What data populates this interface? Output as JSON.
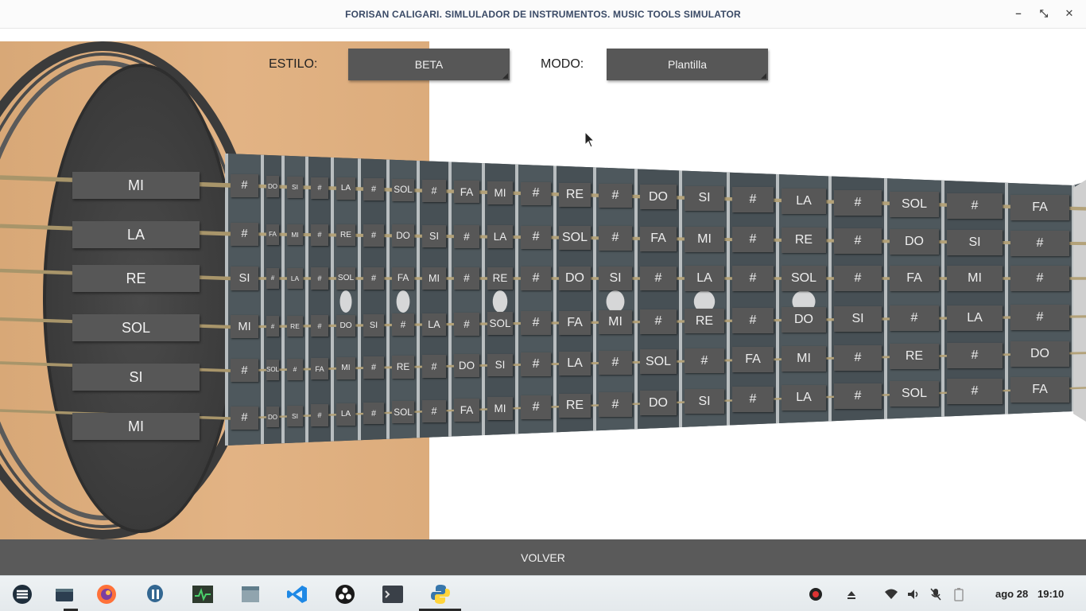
{
  "window": {
    "title": "FORISAN CALIGARI. SIMLULADOR DE INSTRUMENTOS. MUSIC TOOLS SIMULATOR",
    "minimize": "–",
    "maximize": "⤡",
    "close": "✕"
  },
  "controls": {
    "estilo_label": "ESTILO:",
    "estilo_value": "BETA",
    "modo_label": "MODO:",
    "modo_value": "Plantilla"
  },
  "open_strings": [
    "MI",
    "LA",
    "RE",
    "SOL",
    "SI",
    "MI"
  ],
  "fretboard": {
    "frets": 19,
    "rows": [
      [
        "#",
        "DO",
        "SI",
        "#",
        "LA",
        "#",
        "SOL",
        "#",
        "FA",
        "MI",
        "#",
        "RE",
        "#",
        "DO",
        "SI",
        "#",
        "LA",
        "#",
        "SOL",
        "#",
        "FA"
      ],
      [
        "#",
        "FA",
        "MI",
        "#",
        "RE",
        "#",
        "DO",
        "SI",
        "#",
        "LA",
        "#",
        "SOL",
        "#",
        "FA",
        "MI",
        "#",
        "RE",
        "#",
        "DO",
        "SI",
        "#"
      ],
      [
        "SI",
        "#",
        "LA",
        "#",
        "SOL",
        "#",
        "FA",
        "MI",
        "#",
        "RE",
        "#",
        "DO",
        "SI",
        "#",
        "LA",
        "#",
        "SOL",
        "#",
        "FA",
        "MI",
        "#"
      ],
      [
        "MI",
        "#",
        "RE",
        "#",
        "DO",
        "SI",
        "#",
        "LA",
        "#",
        "SOL",
        "#",
        "FA",
        "MI",
        "#",
        "RE",
        "#",
        "DO",
        "SI",
        "#",
        "LA",
        "#"
      ],
      [
        "#",
        "SOL",
        "#",
        "FA",
        "MI",
        "#",
        "RE",
        "#",
        "DO",
        "SI",
        "#",
        "LA",
        "#",
        "SOL",
        "#",
        "FA",
        "MI",
        "#",
        "RE",
        "#",
        "DO"
      ],
      [
        "#",
        "DO",
        "SI",
        "#",
        "LA",
        "#",
        "SOL",
        "#",
        "FA",
        "MI",
        "#",
        "RE",
        "#",
        "DO",
        "SI",
        "#",
        "LA",
        "#",
        "SOL",
        "#",
        "FA"
      ]
    ]
  },
  "volver": "VOLVER",
  "taskbar": {
    "apps": [
      "zorin-menu-icon",
      "files-window-icon",
      "firefox-icon",
      "postgres-icon",
      "system-monitor-icon",
      "file-manager-icon",
      "vscode-icon",
      "obs-icon",
      "terminal-icon",
      "python-icon"
    ],
    "date": "ago 28",
    "time": "19:10"
  },
  "colors": {
    "button": "#575757",
    "neck": "#4a5358",
    "body_wood": "#e2b384",
    "title_text": "#3a4a66"
  }
}
